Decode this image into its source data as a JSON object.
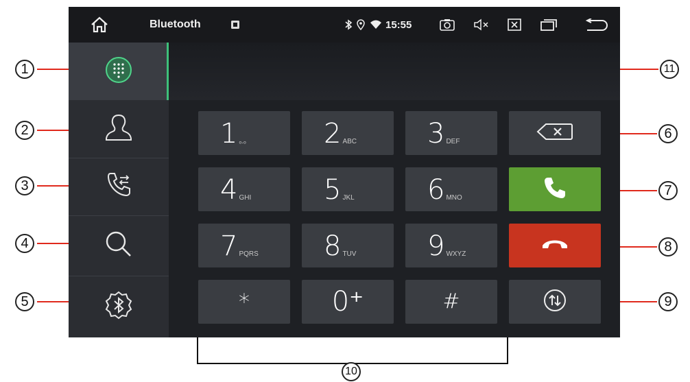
{
  "status_bar": {
    "title": "Bluetooth",
    "time": "15:55"
  },
  "keypad": {
    "keys": [
      {
        "digit": "1",
        "letters": "ₒ.ₒ"
      },
      {
        "digit": "2",
        "letters": "ABC"
      },
      {
        "digit": "3",
        "letters": "DEF"
      },
      {
        "digit": "4",
        "letters": "GHI"
      },
      {
        "digit": "5",
        "letters": "JKL"
      },
      {
        "digit": "6",
        "letters": "MNO"
      },
      {
        "digit": "7",
        "letters": "PQRS"
      },
      {
        "digit": "8",
        "letters": "TUV"
      },
      {
        "digit": "9",
        "letters": "WXYZ"
      },
      {
        "digit": "*",
        "letters": ""
      },
      {
        "digit": "0⁺",
        "letters": ""
      },
      {
        "digit": "#",
        "letters": ""
      }
    ]
  },
  "callouts": [
    "1",
    "2",
    "3",
    "4",
    "5",
    "6",
    "7",
    "8",
    "9",
    "10",
    "11"
  ],
  "colors": {
    "accent_green": "#3ec07a",
    "call_button": "#5d9e33",
    "hangup_button": "#c8341f"
  },
  "icons": {
    "sidebar": [
      "dialpad-icon",
      "contacts-icon",
      "call-log-icon",
      "search-icon",
      "bluetooth-settings-icon"
    ],
    "actions": [
      "backspace-icon",
      "call-icon",
      "hangup-icon",
      "transfer-audio-icon"
    ],
    "status": [
      "home-icon",
      "notification-icon",
      "bluetooth-icon",
      "location-icon",
      "wifi-icon",
      "screenshot-icon",
      "mute-icon",
      "close-app-icon",
      "recent-apps-icon",
      "back-icon"
    ]
  }
}
